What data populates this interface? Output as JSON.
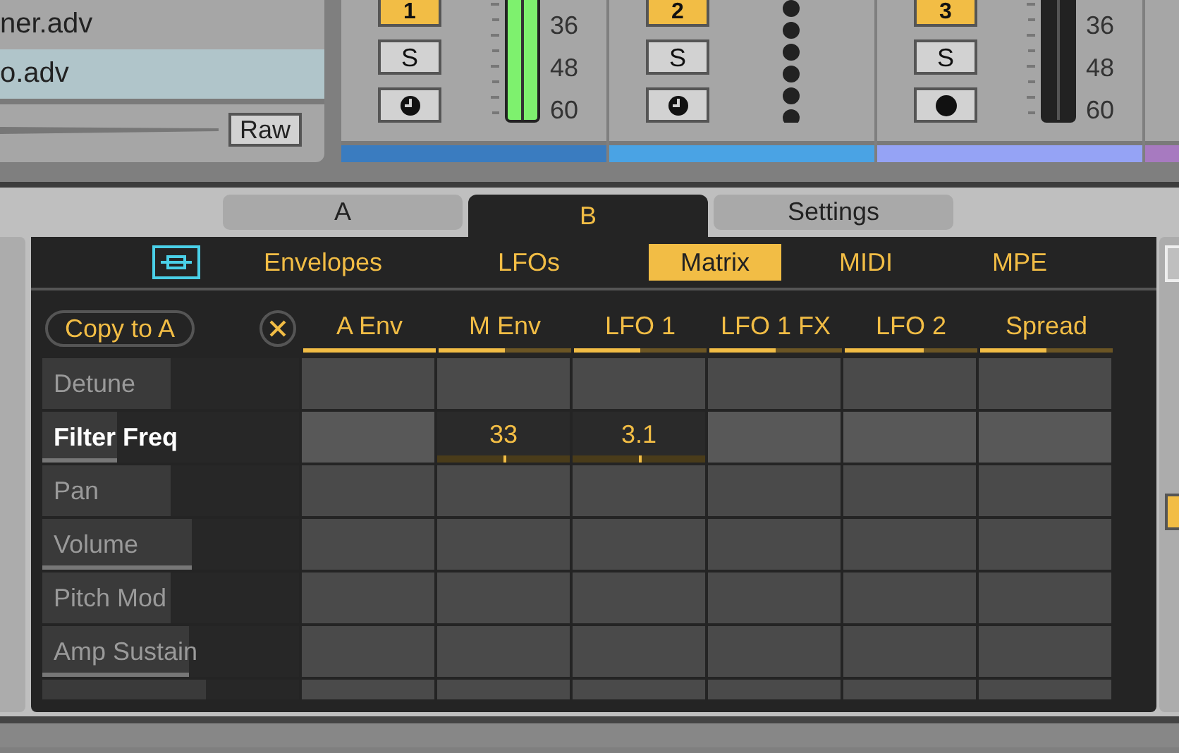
{
  "browser": {
    "items": [
      {
        "label": "ner.adv",
        "selected": false
      },
      {
        "label": "o.adv",
        "selected": true
      }
    ],
    "raw_button": "Raw"
  },
  "tracks": [
    {
      "kind": "signal",
      "buttons": [
        {
          "kind": "number",
          "label": "1"
        },
        {
          "kind": "solo",
          "label": "S"
        },
        {
          "kind": "clock"
        }
      ],
      "scale": [
        "36",
        "48",
        "60"
      ],
      "color": "#3a7cc0"
    },
    {
      "kind": "dots",
      "buttons": [
        {
          "kind": "number",
          "label": "2"
        },
        {
          "kind": "solo",
          "label": "S"
        },
        {
          "kind": "clock"
        }
      ],
      "color": "#4aa3e4"
    },
    {
      "kind": "silent",
      "buttons": [
        {
          "kind": "number",
          "label": "3"
        },
        {
          "kind": "solo",
          "label": "S"
        },
        {
          "kind": "dot"
        }
      ],
      "scale": [
        "36",
        "48",
        "60"
      ],
      "color": "#95a3f5"
    },
    {
      "color": "#a77ac0"
    }
  ],
  "tabs": [
    {
      "label": "A",
      "selected": false
    },
    {
      "label": "B",
      "selected": true
    },
    {
      "label": "Settings",
      "selected": false
    }
  ],
  "subtabs": [
    {
      "label": "Envelopes",
      "selected": false
    },
    {
      "label": "LFOs",
      "selected": false
    },
    {
      "label": "Matrix",
      "selected": true
    },
    {
      "label": "MIDI",
      "selected": false
    },
    {
      "label": "MPE",
      "selected": false
    }
  ],
  "matrix": {
    "copy_button": "Copy to A",
    "columns": [
      {
        "label": "A Env",
        "level": 1
      },
      {
        "label": "M Env",
        "level": 0.5
      },
      {
        "label": "LFO 1",
        "level": 0.5
      },
      {
        "label": "LFO 1 FX",
        "level": 0.5
      },
      {
        "label": "LFO 2",
        "level": 0.6
      },
      {
        "label": "Spread",
        "level": 0.5
      }
    ],
    "rows": [
      {
        "label": "Detune",
        "selected": false,
        "level": 0.5,
        "modulated": false
      },
      {
        "label": "Filter Freq",
        "selected": true,
        "level": 0.29,
        "modulated": true,
        "cells": [
          "",
          "33",
          "3.1",
          "",
          "",
          ""
        ]
      },
      {
        "label": "Pan",
        "selected": false,
        "level": 0.5,
        "modulated": false
      },
      {
        "label": "Volume",
        "selected": false,
        "level": 0.58,
        "modulated": true
      },
      {
        "label": "Pitch Mod",
        "selected": false,
        "level": 0.5,
        "modulated": false
      },
      {
        "label": "Amp Sustain",
        "selected": false,
        "level": 0.57,
        "modulated": true
      },
      {
        "level": 0.64
      }
    ]
  }
}
